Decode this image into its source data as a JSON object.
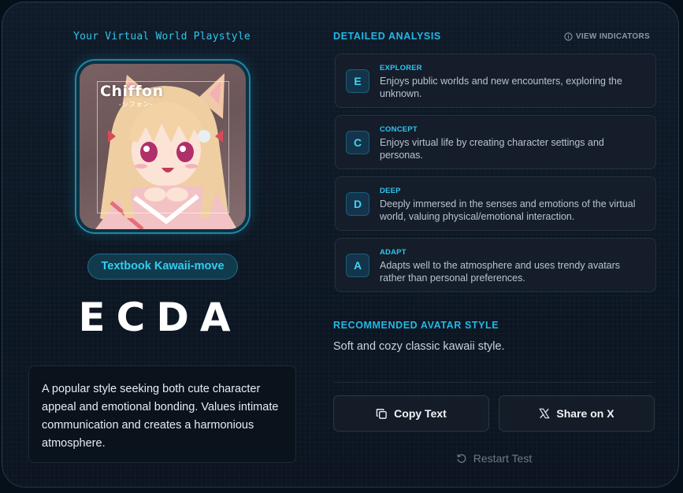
{
  "left": {
    "playstyle_title": "Your Virtual World Playstyle",
    "avatar_logo": "Chiffon",
    "avatar_logo_sub": "-シフォン-",
    "badge": "Textbook Kawaii-move",
    "type_code": "ECDA",
    "description": "A popular style seeking both cute character appeal and emotional bonding. Values intimate communication and creates a harmonious atmosphere."
  },
  "analysis": {
    "title": "DETAILED ANALYSIS",
    "view_indicators": "VIEW INDICATORS",
    "traits": [
      {
        "letter": "E",
        "name": "EXPLORER",
        "desc": "Enjoys public worlds and new encounters, exploring the unknown."
      },
      {
        "letter": "C",
        "name": "CONCEPT",
        "desc": "Enjoys virtual life by creating character settings and personas."
      },
      {
        "letter": "D",
        "name": "DEEP",
        "desc": "Deeply immersed in the senses and emotions of the virtual world, valuing physical/emotional interaction."
      },
      {
        "letter": "A",
        "name": "ADAPT",
        "desc": "Adapts well to the atmosphere and uses trendy avatars rather than personal preferences."
      }
    ]
  },
  "recommended": {
    "title": "RECOMMENDED AVATAR STYLE",
    "text": "Soft and cozy classic kawaii style."
  },
  "actions": {
    "copy_label": "Copy Text",
    "share_label": "Share on X",
    "restart_label": "Restart Test"
  },
  "icons": {
    "info": "info-icon",
    "copy": "copy-icon",
    "x_logo": "x-logo-icon",
    "restart": "restart-icon"
  },
  "colors": {
    "accent": "#2fc6ea",
    "background": "#0b1420",
    "card": "#141d29"
  }
}
